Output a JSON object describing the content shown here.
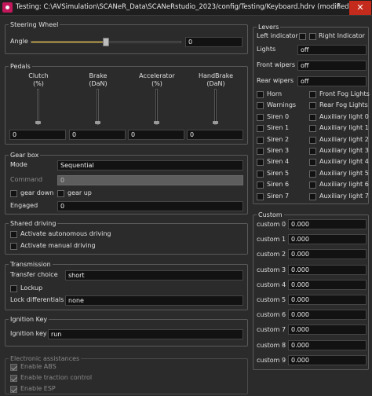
{
  "window": {
    "title": "Testing: C:\\AVSimulation\\SCANeR_Data\\SCANeRstudio_2023/config/Testing/Keyboard.hdrv (modified)",
    "help_label": "?",
    "close_label": "✕"
  },
  "steering": {
    "title": "Steering Wheel",
    "angle_label": "Angle",
    "angle_value": "0",
    "slider_level_percent": 50
  },
  "pedals": {
    "title": "Pedals",
    "items": [
      {
        "name": "Clutch",
        "unit": "(%)",
        "value": "0"
      },
      {
        "name": "Brake",
        "unit": "(DaN)",
        "value": "0"
      },
      {
        "name": "Accelerator",
        "unit": "(%)",
        "value": "0"
      },
      {
        "name": "HandBrake",
        "unit": "(DaN)",
        "value": "0"
      }
    ]
  },
  "gearbox": {
    "title": "Gear box",
    "mode_label": "Mode",
    "mode_value": "Sequential",
    "command_label": "Command",
    "command_value": "0",
    "gear_down_label": "gear down",
    "gear_up_label": "gear up",
    "engaged_label": "Engaged",
    "engaged_value": "0"
  },
  "shared_driving": {
    "title": "Shared driving",
    "activate_autonomous_label": "Activate autonomous driving",
    "activate_manual_label": "Activate manual driving"
  },
  "transmission": {
    "title": "Transmission",
    "transfer_choice_label": "Transfer choice",
    "transfer_choice_value": "short",
    "lockup_label": "Lockup",
    "lock_differentials_label": "Lock differentials",
    "lock_differentials_value": "none"
  },
  "ignition": {
    "title": "Ignition Key",
    "key_label": "Ignition key",
    "key_value": "run"
  },
  "electronic": {
    "title": "Electronic assistances",
    "items": [
      "Enable ABS",
      "Enable traction control",
      "Enable ESP"
    ]
  },
  "levers": {
    "title": "Levers",
    "left_indicator_label": "Left indicator",
    "right_indicator_label": "Right Indicator",
    "lights_label": "Lights",
    "lights_value": "off",
    "front_wipers_label": "Front wipers",
    "front_wipers_value": "off",
    "rear_wipers_label": "Rear wipers",
    "rear_wipers_value": "off",
    "left_checks": [
      "Horn",
      "Warnings",
      "Siren 0",
      "Siren 1",
      "Siren 2",
      "Siren 3",
      "Siren 4",
      "Siren 5",
      "Siren 6",
      "Siren 7"
    ],
    "right_checks": [
      "Front Fog Lights",
      "Rear Fog Lights",
      "Auxiliary light 0",
      "Auxiliary light 1",
      "Auxiliary light 2",
      "Auxiliary light 3",
      "Auxiliary light 4",
      "Auxiliary light 5",
      "Auxiliary light 6",
      "Auxiliary light 7"
    ]
  },
  "custom": {
    "title": "Custom",
    "items": [
      {
        "label": "custom 0",
        "value": "0.000"
      },
      {
        "label": "custom 1",
        "value": "0.000"
      },
      {
        "label": "custom 2",
        "value": "0.000"
      },
      {
        "label": "custom 3",
        "value": "0.000"
      },
      {
        "label": "custom 4",
        "value": "0.000"
      },
      {
        "label": "custom 5",
        "value": "0.000"
      },
      {
        "label": "custom 6",
        "value": "0.000"
      },
      {
        "label": "custom 7",
        "value": "0.000"
      },
      {
        "label": "custom 8",
        "value": "0.000"
      },
      {
        "label": "custom 9",
        "value": "0.000"
      }
    ]
  },
  "colors": {
    "background": "#2b2b2b",
    "accent": "#f0c020",
    "close_button": "#c42b1c",
    "field_background": "#121212"
  }
}
